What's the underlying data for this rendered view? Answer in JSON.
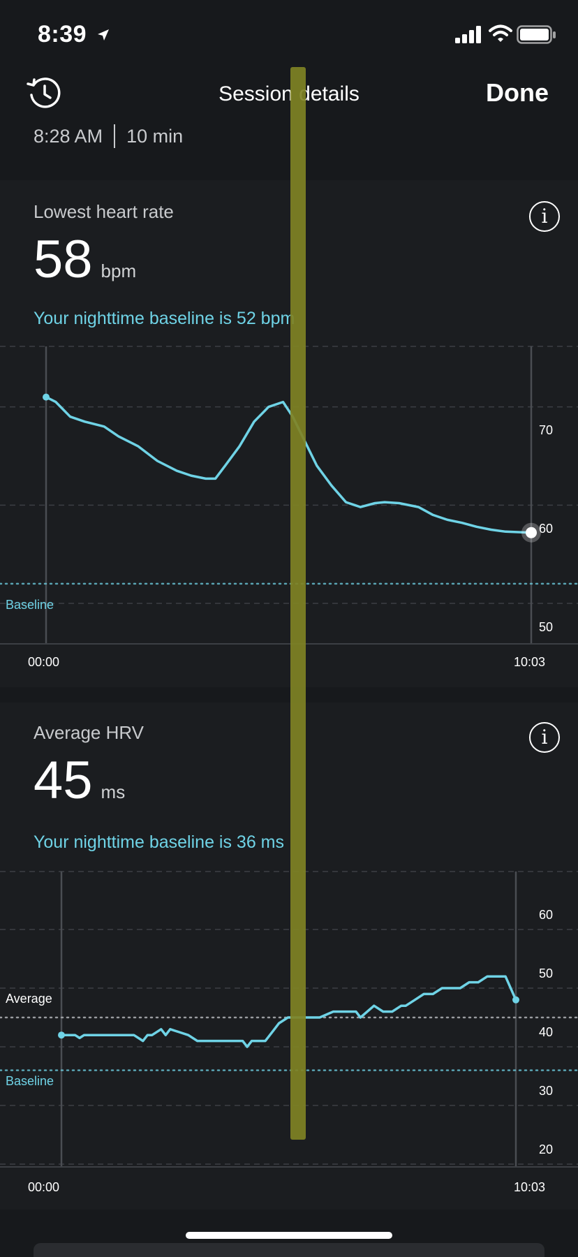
{
  "status_bar": {
    "time": "8:39"
  },
  "header": {
    "title": "Session details",
    "done_label": "Done",
    "history_icon": "history-icon"
  },
  "session": {
    "start_time": "8:28 AM",
    "duration": "10 min"
  },
  "hr_card": {
    "title": "Lowest heart rate",
    "value": "58",
    "unit": "bpm",
    "baseline_text": "Your nighttime baseline is 52 bpm",
    "baseline_label": "Baseline",
    "x_start": "00:00",
    "x_end": "10:03",
    "y_ticks": [
      "70",
      "60",
      "50"
    ]
  },
  "hrv_card": {
    "title": "Average HRV",
    "value": "45",
    "unit": "ms",
    "baseline_text": "Your nighttime baseline is 36 ms",
    "average_label": "Average",
    "baseline_label": "Baseline",
    "x_start": "00:00",
    "x_end": "10:03",
    "y_ticks": [
      "60",
      "50",
      "40",
      "30",
      "20"
    ]
  },
  "colors": {
    "accent": "#6fd3e6",
    "highlight": "#7f8224",
    "background": "#17191c",
    "card": "#1b1d20"
  },
  "chart_data": [
    {
      "type": "line",
      "title": "Lowest heart rate",
      "ylabel": "",
      "ylim": [
        50,
        80
      ],
      "yticks": [
        50,
        60,
        70
      ],
      "x_range": [
        "00:00",
        "10:03"
      ],
      "baseline": 52,
      "series": [
        {
          "x": [
            0,
            0.2,
            0.5,
            0.8,
            1.2,
            1.5,
            1.9,
            2.3,
            2.7,
            3.0,
            3.3,
            3.5,
            3.7,
            4.0,
            4.3,
            4.6,
            4.9,
            5.1,
            5.3,
            5.6,
            5.9,
            6.2,
            6.5,
            6.8,
            7.0,
            7.3,
            7.7,
            8.0,
            8.3,
            8.6,
            8.9,
            9.2,
            9.5,
            10.03
          ],
          "y": [
            71,
            70.5,
            69,
            68.5,
            68,
            67,
            66,
            64.5,
            63.5,
            63,
            62.7,
            62.7,
            64,
            66,
            68.5,
            70,
            70.5,
            69,
            67,
            64,
            62,
            60.3,
            59.8,
            60.2,
            60.3,
            60.2,
            59.8,
            59,
            58.5,
            58.2,
            57.8,
            57.5,
            57.3,
            57.2
          ]
        }
      ]
    },
    {
      "type": "line",
      "title": "Average HRV",
      "ylabel": "",
      "ylim": [
        20,
        60
      ],
      "yticks": [
        20,
        30,
        40,
        50,
        60
      ],
      "x_range": [
        "00:00",
        "10:03"
      ],
      "average": 45,
      "baseline": 36,
      "series": [
        {
          "x": [
            0,
            0.3,
            0.4,
            0.5,
            0.8,
            1.2,
            1.6,
            1.8,
            1.9,
            2.0,
            2.2,
            2.3,
            2.4,
            2.6,
            2.8,
            3.0,
            3.3,
            3.6,
            4.0,
            4.1,
            4.2,
            4.3,
            4.5,
            4.7,
            4.8,
            5.0,
            5.2,
            5.3,
            5.5,
            5.7,
            6.0,
            6.3,
            6.5,
            6.6,
            6.9,
            7.1,
            7.3,
            7.5,
            7.6,
            7.8,
            8.0,
            8.2,
            8.4,
            8.6,
            8.8,
            9.0,
            9.2,
            9.4,
            9.6,
            9.8,
            10.03
          ],
          "y": [
            42,
            42,
            41.5,
            42,
            42,
            42,
            42,
            41,
            42,
            42,
            43,
            42,
            43,
            42.5,
            42,
            41,
            41,
            41,
            41,
            40,
            41,
            41,
            41,
            43,
            44,
            45,
            45,
            45,
            45,
            45,
            46,
            46,
            46,
            45,
            47,
            46,
            46,
            47,
            47,
            48,
            49,
            49,
            50,
            50,
            50,
            51,
            51,
            52,
            52,
            52,
            48
          ]
        }
      ]
    }
  ]
}
